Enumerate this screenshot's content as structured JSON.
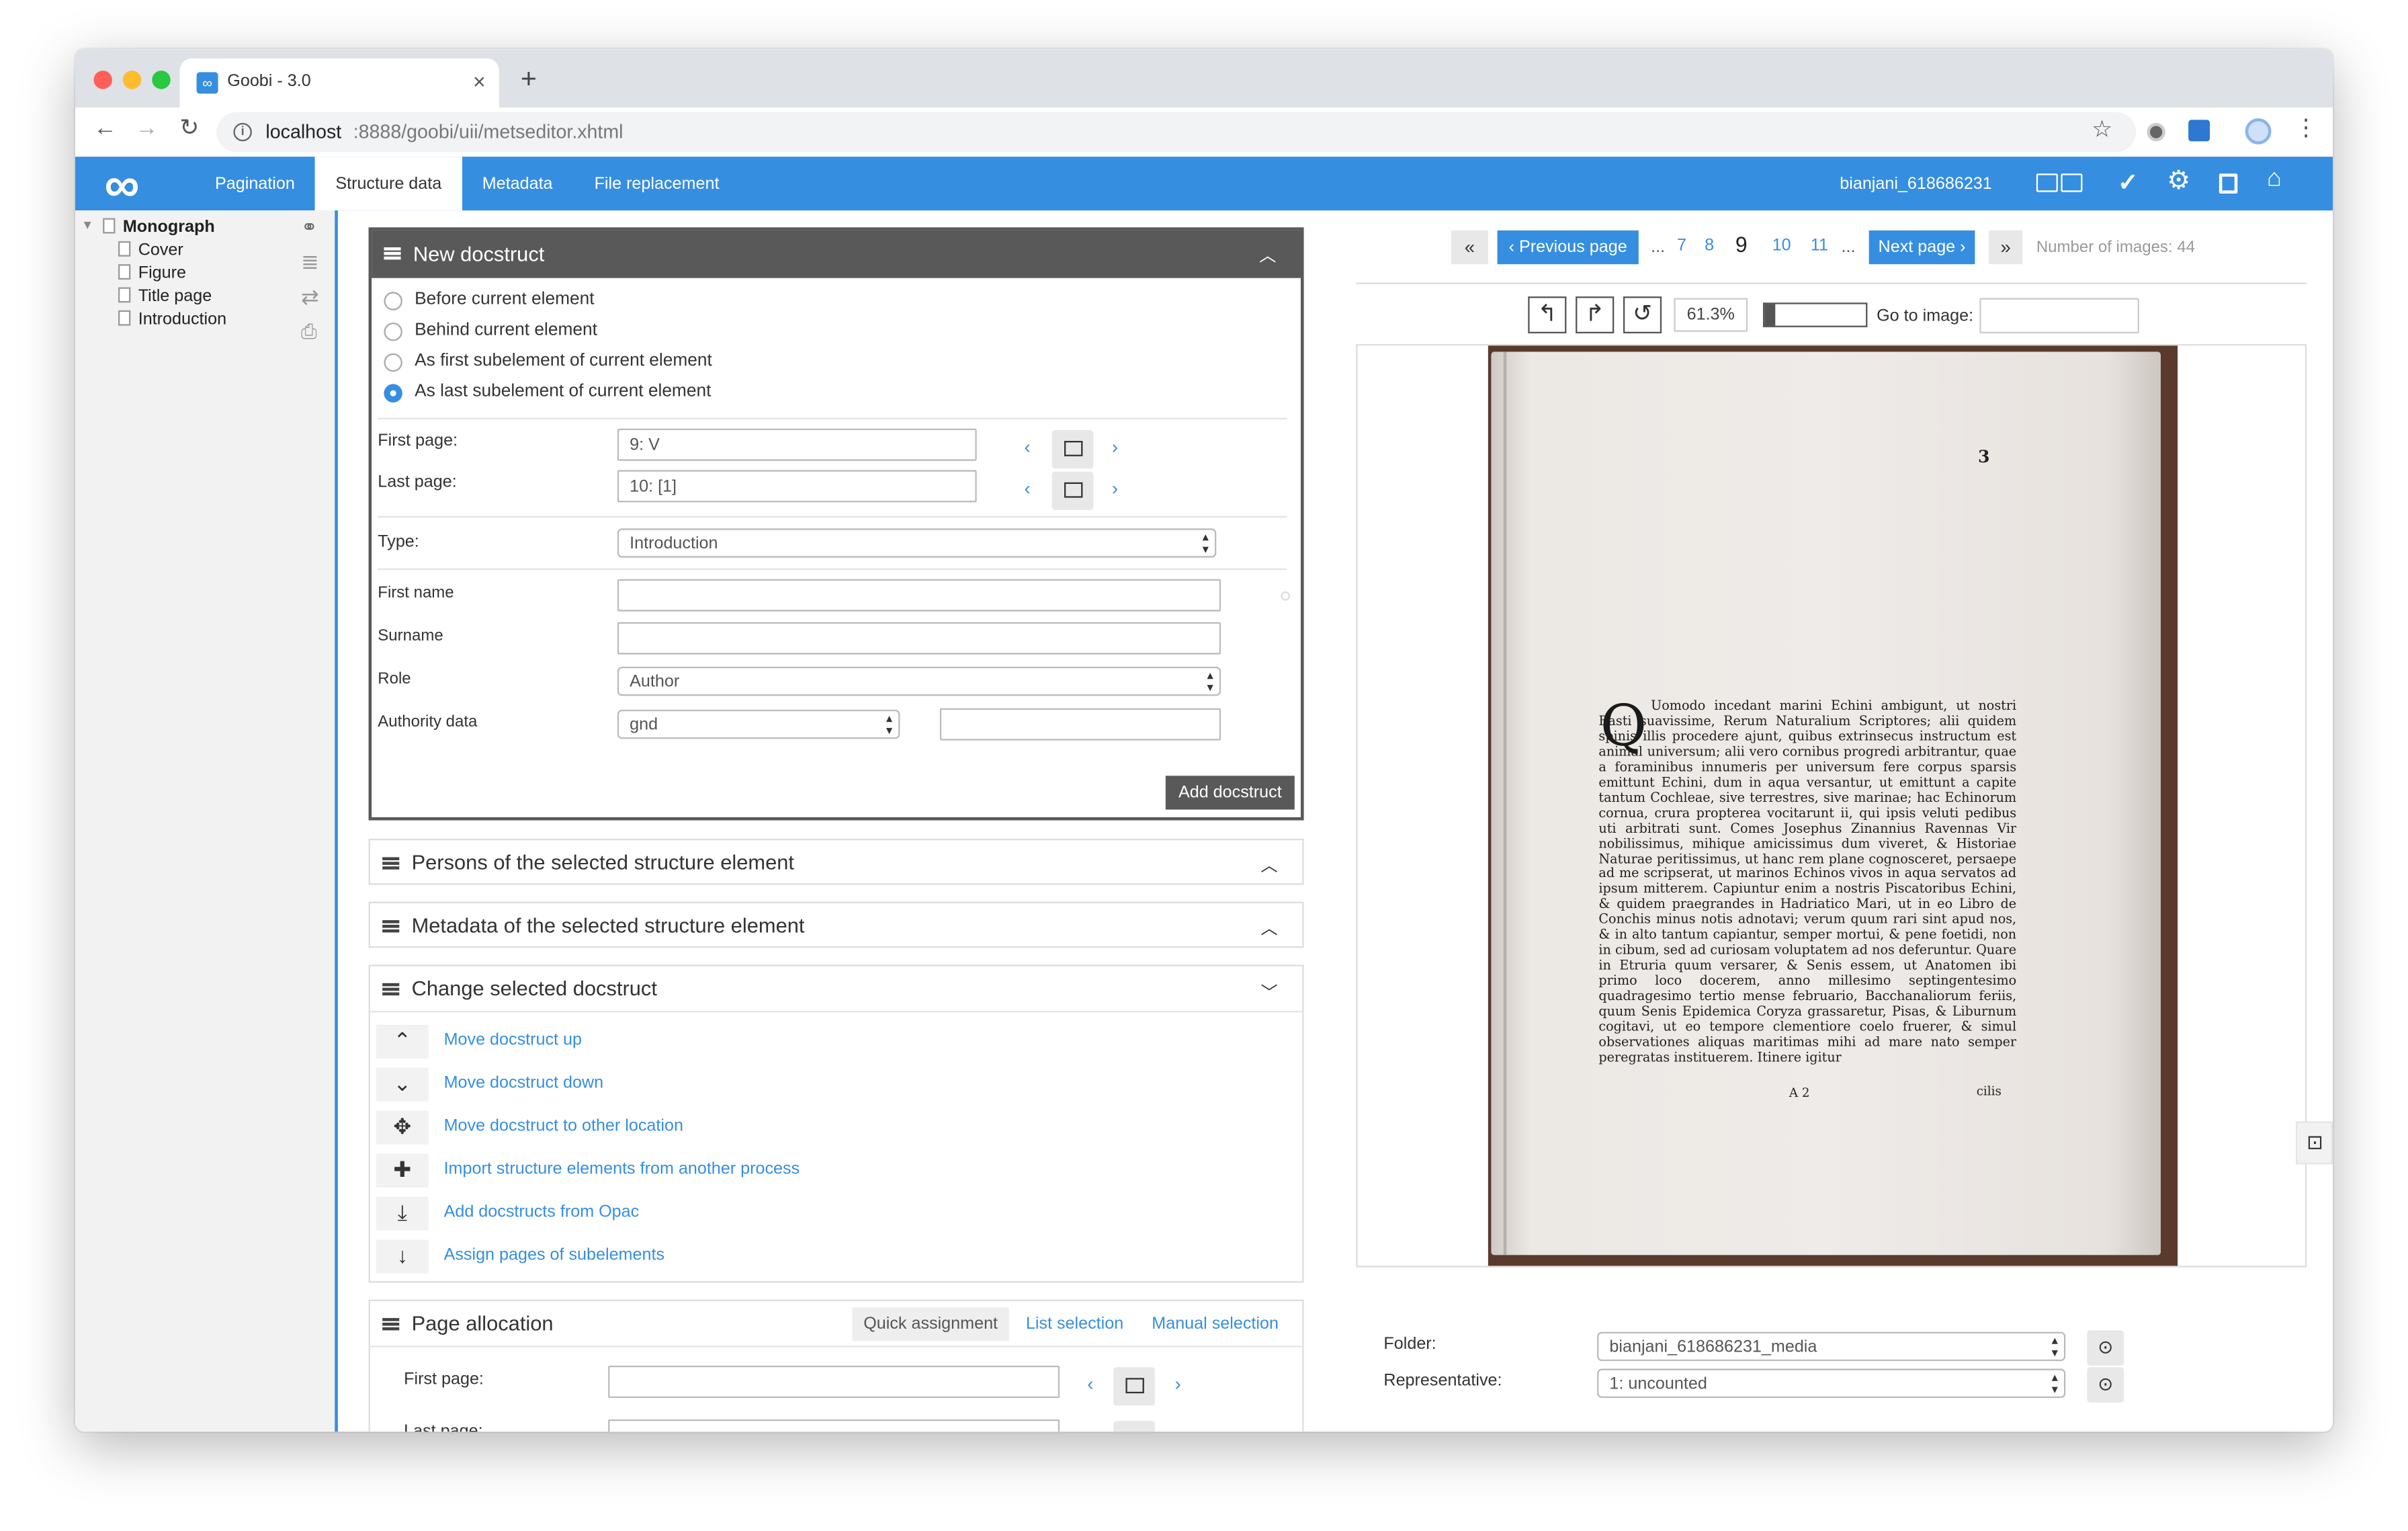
{
  "browser": {
    "tab_title": "Goobi - 3.0",
    "tab_close": "×",
    "new_tab": "+",
    "url_host": "localhost",
    "url_rest": ":8888/goobi/uii/metseditor.xhtml"
  },
  "app": {
    "logo": "∞",
    "nav": [
      "Pagination",
      "Structure data",
      "Metadata",
      "File replacement"
    ],
    "user": "bianjani_618686231"
  },
  "tree": {
    "root": "Monograph",
    "children": [
      "Cover",
      "Figure",
      "Title page",
      "Introduction"
    ]
  },
  "new_docstruct": {
    "title": "New docstruct",
    "options": [
      "Before current element",
      "Behind current element",
      "As first subelement of current element",
      "As last subelement of current element"
    ],
    "selected_option": 3,
    "first_page_label": "First page:",
    "first_page_value": "9: V",
    "last_page_label": "Last page:",
    "last_page_value": "10: [1]",
    "type_label": "Type:",
    "type_value": "Introduction",
    "first_name_label": "First name",
    "surname_label": "Surname",
    "role_label": "Role",
    "role_value": "Author",
    "authority_label": "Authority data",
    "authority_value": "gnd",
    "add_button": "Add docstruct"
  },
  "panels": {
    "persons": "Persons of the selected structure element",
    "metadata": "Metadata of the selected structure element",
    "change": "Change selected docstruct"
  },
  "change_actions": [
    "Move docstruct up",
    "Move docstruct down",
    "Move docstruct to other location",
    "Import structure elements from another process",
    "Add docstructs from Opac",
    "Assign pages of subelements"
  ],
  "page_allocation": {
    "title": "Page allocation",
    "tabs": [
      "Quick assignment",
      "List selection",
      "Manual selection"
    ],
    "first_page_label": "First page:",
    "last_page_label": "Last page:"
  },
  "viewer": {
    "first": "«",
    "prev_label": "‹ Previous page",
    "ellipsis": "...",
    "pages": [
      "7",
      "8",
      "9",
      "10",
      "11"
    ],
    "current_page": "9",
    "next_label": "Next page ›",
    "last": "»",
    "num_images": "Number of images: 44",
    "zoom": "61.3%",
    "goto_label": "Go to image:",
    "page_number": "3",
    "scan_text": "Uomodo incedant marini Echini ambigunt, ut nostri Basti suavissime, Rerum Naturalium Scriptores; alii quidem spinis illis procedere ajunt, quibus extrinsecus instructum est animal universum; alii vero cornibus progredi arbitrantur, quae a foraminibus innumeris per universum fere corpus sparsis emittunt Echini, dum in aqua versantur, ut emittunt a capite tantum Cochleae, sive terrestres, sive marinae; hac Echinorum cornua, crura propterea vocitarunt ii, qui ipsis veluti pedibus uti arbitrati sunt. Comes Josephus Zinannius Ravennas Vir nobilissimus, mihique amicissimus dum viveret, & Historiae Naturae peritissimus, ut hanc rem plane cognosceret, persaepe ad me scripserat, ut marinos Echinos vivos in aqua servatos ad ipsum mitterem. Capiuntur enim a nostris Piscatoribus Echini, & quidem praegrandes in Hadriatico Mari, ut in eo Libro de Conchis minus notis adnotavi; verum quum rari sint apud nos, & in alto tantum capiantur, semper mortui, & pene foetidi, non in cibum, sed ad curiosam voluptatem ad nos deferuntur. Quare in Etruria quum versarer, & Senis essem, ut Anatomen ibi primo loco docerem, anno millesimo septingentesimo quadragesimo tertio mense februario, Bacchanaliorum feriis, quum Senis Epidemica Coryza grassaretur, Pisas, & Liburnum cogitavi, ut eo tempore clementiore coelo fruerer, & simul observationes aliquas maritimas mihi ad mare nato semper peregratas instituerem. Itinere igitur",
    "scan_initial": "Q",
    "signature": "A 2",
    "catchword": "cilis",
    "folder_label": "Folder:",
    "folder_value": "bianjani_618686231_media",
    "rep_label": "Representative:",
    "rep_value": "1: uncounted"
  },
  "colors": {
    "accent": "#368ee0",
    "panel_header": "#595959"
  }
}
